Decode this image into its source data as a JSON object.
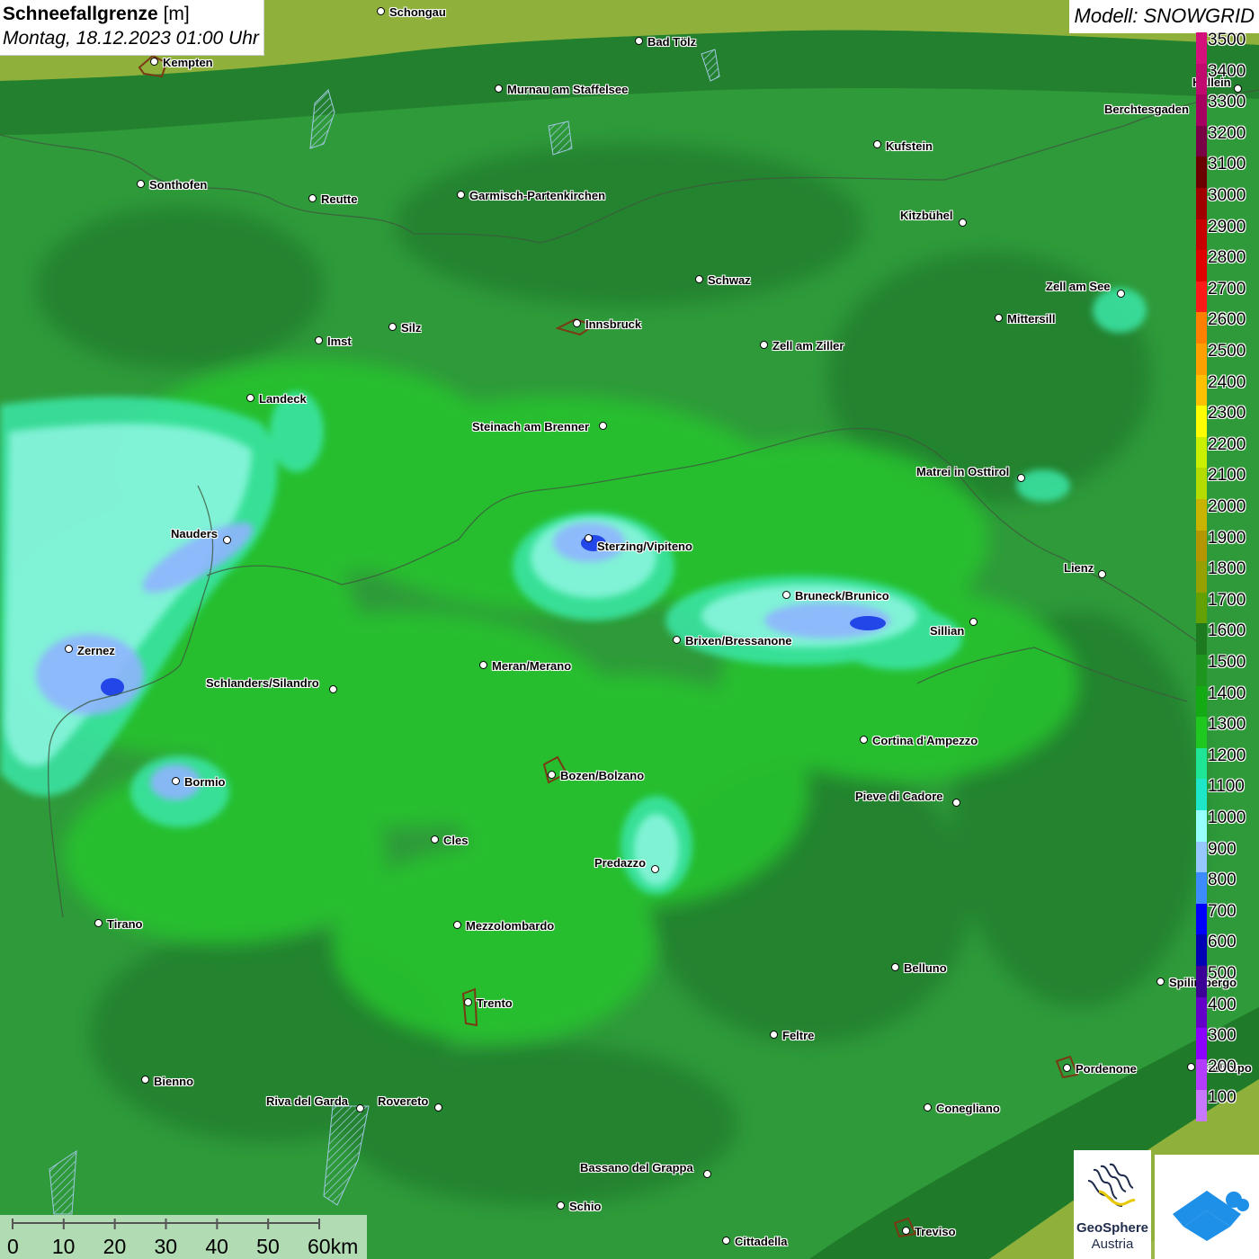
{
  "header": {
    "title": "Schneefallgrenze",
    "unit": "[m]",
    "date": "Montag, 18.12.2023 01:00 Uhr",
    "model": "Modell: SNOWGRID"
  },
  "legend": {
    "labels": [
      "3500",
      "3400",
      "3300",
      "3200",
      "3100",
      "3000",
      "2900",
      "2800",
      "2700",
      "2600",
      "2500",
      "2400",
      "2300",
      "2200",
      "2100",
      "2000",
      "1900",
      "1800",
      "1700",
      "1600",
      "1500",
      "1400",
      "1300",
      "1200",
      "1100",
      "1000",
      "900",
      "800",
      "700",
      "600",
      "500",
      "400",
      "300",
      "200",
      "100"
    ],
    "colors": [
      "#d4107a",
      "#c00a6e",
      "#a50060",
      "#7a0045",
      "#6a0000",
      "#a00000",
      "#c80000",
      "#e00000",
      "#ff1a1a",
      "#ff7f00",
      "#ff9f00",
      "#ffc000",
      "#ffff00",
      "#c8f000",
      "#b4dc00",
      "#c8b400",
      "#b49600",
      "#96a000",
      "#64a000",
      "#1e7a1e",
      "#1e961e",
      "#14aa14",
      "#1ec81e",
      "#1ee696",
      "#1ee6c8",
      "#96ffff",
      "#96c8ff",
      "#3c8cff",
      "#0000ff",
      "#0000b4",
      "#3c0096",
      "#6400c8",
      "#8c00ff",
      "#b43cff",
      "#c878ff"
    ]
  },
  "cities": [
    {
      "name": "Schongau",
      "dot": [
        424,
        13
      ],
      "lbl": [
        433,
        7
      ]
    },
    {
      "name": "Kempten",
      "dot": [
        172,
        69
      ],
      "lbl": [
        181,
        63
      ]
    },
    {
      "name": "Bad Tölz",
      "dot": [
        711,
        46
      ],
      "lbl": [
        720,
        40
      ]
    },
    {
      "name": "Murnau am Staffelsee",
      "dot": [
        555,
        99
      ],
      "lbl": [
        564,
        93
      ]
    },
    {
      "name": "Kufstein",
      "dot": [
        976,
        161
      ],
      "lbl": [
        985,
        156
      ]
    },
    {
      "name": "Berchtesgaden",
      "dot": null,
      "lbl": [
        1228,
        115
      ]
    },
    {
      "name": "Sonthofen",
      "dot": [
        157,
        205
      ],
      "lbl": [
        166,
        199
      ]
    },
    {
      "name": "Reutte",
      "dot": [
        348,
        221
      ],
      "lbl": [
        357,
        215
      ]
    },
    {
      "name": "Garmisch-Partenkirchen",
      "dot": [
        513,
        217
      ],
      "lbl": [
        522,
        211
      ]
    },
    {
      "name": "Kitzbühel",
      "dot": [
        1071,
        248
      ],
      "lbl": [
        1001,
        233
      ]
    },
    {
      "name": "Schwaz",
      "dot": [
        778,
        311
      ],
      "lbl": [
        787,
        305
      ]
    },
    {
      "name": "Zell am See",
      "dot": [
        1247,
        327
      ],
      "lbl": [
        1163,
        312
      ]
    },
    {
      "name": "Mittersill",
      "dot": [
        1111,
        354
      ],
      "lbl": [
        1120,
        348
      ]
    },
    {
      "name": "Innsbruck",
      "dot": [
        642,
        360
      ],
      "lbl": [
        651,
        354
      ]
    },
    {
      "name": "Silz",
      "dot": [
        437,
        364
      ],
      "lbl": [
        446,
        358
      ]
    },
    {
      "name": "Imst",
      "dot": [
        355,
        379
      ],
      "lbl": [
        364,
        373
      ]
    },
    {
      "name": "Zell am Ziller",
      "dot": [
        850,
        384
      ],
      "lbl": [
        859,
        378
      ]
    },
    {
      "name": "Landeck",
      "dot": [
        279,
        443
      ],
      "lbl": [
        288,
        437
      ]
    },
    {
      "name": "Steinach am Brenner",
      "dot": [
        671,
        474
      ],
      "lbl": [
        525,
        468
      ]
    },
    {
      "name": "Matrei in Osttirol",
      "dot": [
        1136,
        532
      ],
      "lbl": [
        1019,
        518
      ]
    },
    {
      "name": "Nauders",
      "dot": [
        253,
        601
      ],
      "lbl": [
        190,
        587
      ]
    },
    {
      "name": "Sterzing/Vipiteno",
      "dot": [
        655,
        599
      ],
      "lbl": [
        664,
        601
      ]
    },
    {
      "name": "Lienz",
      "dot": [
        1226,
        639
      ],
      "lbl": [
        1183,
        625
      ]
    },
    {
      "name": "Bruneck/Brunico",
      "dot": [
        875,
        662
      ],
      "lbl": [
        884,
        656
      ]
    },
    {
      "name": "Sillian",
      "dot": [
        1083,
        692
      ],
      "lbl": [
        1034,
        695
      ]
    },
    {
      "name": "Brixen/Bressanone",
      "dot": [
        753,
        712
      ],
      "lbl": [
        762,
        706
      ]
    },
    {
      "name": "Zernez",
      "dot": [
        77,
        722
      ],
      "lbl": [
        86,
        717
      ]
    },
    {
      "name": "Meran/Merano",
      "dot": [
        538,
        740
      ],
      "lbl": [
        547,
        734
      ]
    },
    {
      "name": "Schlanders/Silandro",
      "dot": [
        371,
        767
      ],
      "lbl": [
        229,
        753
      ]
    },
    {
      "name": "Cortina d'Ampezzo",
      "dot": [
        961,
        823
      ],
      "lbl": [
        970,
        817
      ]
    },
    {
      "name": "Bozen/Bolzano",
      "dot": [
        614,
        862
      ],
      "lbl": [
        623,
        856
      ]
    },
    {
      "name": "Bormio",
      "dot": [
        196,
        869
      ],
      "lbl": [
        205,
        863
      ]
    },
    {
      "name": "Pieve di Cadore",
      "dot": [
        1064,
        893
      ],
      "lbl": [
        951,
        879
      ]
    },
    {
      "name": "Cles",
      "dot": [
        484,
        934
      ],
      "lbl": [
        493,
        928
      ]
    },
    {
      "name": "Predazzo",
      "dot": [
        729,
        967
      ],
      "lbl": [
        661,
        953
      ]
    },
    {
      "name": "Tirano",
      "dot": [
        110,
        1027
      ],
      "lbl": [
        119,
        1021
      ]
    },
    {
      "name": "Mezzolombardo",
      "dot": [
        509,
        1029
      ],
      "lbl": [
        518,
        1023
      ]
    },
    {
      "name": "Belluno",
      "dot": [
        996,
        1076
      ],
      "lbl": [
        1005,
        1070
      ]
    },
    {
      "name": "Spilimbergo",
      "dot": [
        1291,
        1092
      ],
      "lbl": [
        1300,
        1086
      ]
    },
    {
      "name": "Trento",
      "dot": [
        521,
        1115
      ],
      "lbl": [
        530,
        1109
      ]
    },
    {
      "name": "Feltre",
      "dot": [
        861,
        1151
      ],
      "lbl": [
        870,
        1145
      ]
    },
    {
      "name": "Pordenone",
      "dot": [
        1187,
        1188
      ],
      "lbl": [
        1196,
        1182
      ]
    },
    {
      "name": "Codroipo",
      "dot": [
        1325,
        1187
      ],
      "lbl": [
        1334,
        1181
      ]
    },
    {
      "name": "Bienno",
      "dot": [
        162,
        1201
      ],
      "lbl": [
        171,
        1196
      ]
    },
    {
      "name": "Riva del Garda",
      "dot": [
        401,
        1233
      ],
      "lbl": [
        296,
        1218
      ]
    },
    {
      "name": "Rovereto",
      "dot": [
        488,
        1232
      ],
      "lbl": [
        420,
        1218
      ]
    },
    {
      "name": "Conegliano",
      "dot": [
        1032,
        1232
      ],
      "lbl": [
        1041,
        1226
      ]
    },
    {
      "name": "Bassano del Grappa",
      "dot": [
        787,
        1306
      ],
      "lbl": [
        645,
        1292
      ]
    },
    {
      "name": "Schio",
      "dot": [
        624,
        1341
      ],
      "lbl": [
        633,
        1335
      ]
    },
    {
      "name": "Treviso",
      "dot": [
        1008,
        1369
      ],
      "lbl": [
        1017,
        1363
      ]
    },
    {
      "name": "Cittadella",
      "dot": [
        808,
        1380
      ],
      "lbl": [
        817,
        1374
      ]
    },
    {
      "name": "Hallein",
      "dot": [
        1377,
        99
      ],
      "lbl": [
        1326,
        85
      ]
    }
  ],
  "scale": {
    "labels": [
      "0",
      "10",
      "20",
      "30",
      "40",
      "50",
      "60km"
    ]
  },
  "logos": {
    "geosphere_name": "GeoSphere",
    "geosphere_country": "Austria"
  }
}
